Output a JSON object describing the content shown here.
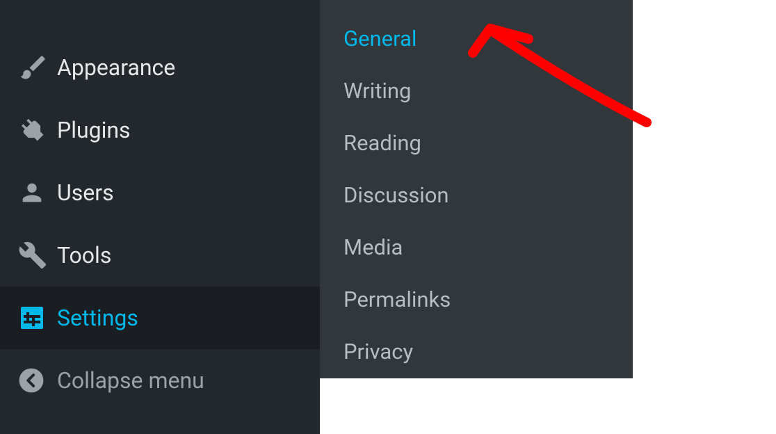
{
  "sidebar": {
    "items": [
      {
        "label": "Appearance",
        "icon": "brush-icon"
      },
      {
        "label": "Plugins",
        "icon": "plug-icon"
      },
      {
        "label": "Users",
        "icon": "user-icon"
      },
      {
        "label": "Tools",
        "icon": "wrench-icon"
      },
      {
        "label": "Settings",
        "icon": "sliders-icon"
      }
    ],
    "collapse_label": "Collapse menu"
  },
  "submenu": {
    "items": [
      {
        "label": "General"
      },
      {
        "label": "Writing"
      },
      {
        "label": "Reading"
      },
      {
        "label": "Discussion"
      },
      {
        "label": "Media"
      },
      {
        "label": "Permalinks"
      },
      {
        "label": "Privacy"
      }
    ]
  },
  "colors": {
    "accent": "#00b9eb",
    "sidebar_bg": "#23282d",
    "submenu_bg": "#32373c",
    "annotation": "#fe0000"
  }
}
